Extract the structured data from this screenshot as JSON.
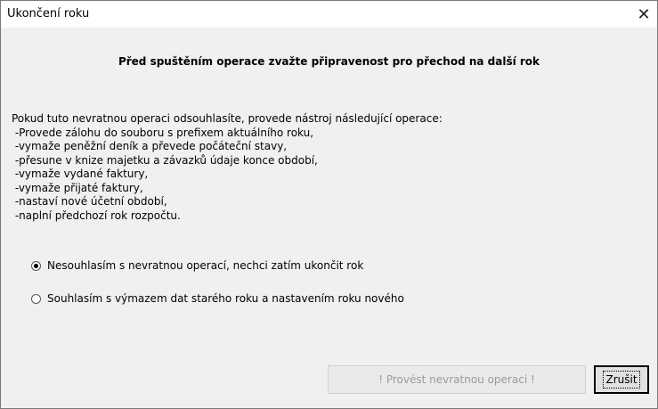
{
  "window": {
    "title": "Ukončení roku"
  },
  "heading": "Před spuštěním operace zvažte připravenost pro přechod na další rok",
  "body_lines": [
    "Pokud tuto nevratnou operaci odsouhlasíte, provede nástroj následující operace:",
    " -Provede zálohu do souboru s prefixem aktuálního roku,",
    " -vymaže peněžní deník a převede počáteční stavy,",
    " -přesune v knize majetku a závazků údaje konce období,",
    " -vymaže vydané faktury,",
    " -vymaže přijaté faktury,",
    " -nastaví nové účetní období,",
    " -naplní předchozí rok rozpočtu."
  ],
  "options": [
    {
      "label": "Nesouhlasím s nevratnou operací, nechci zatím ukončit rok",
      "selected": true
    },
    {
      "label": "Souhlasím s výmazem dat starého roku a nastavením roku nového",
      "selected": false
    }
  ],
  "buttons": {
    "execute": "! Provést nevratnou operaci !",
    "cancel": "Zrušit"
  },
  "icons": {
    "close": "close-icon"
  }
}
